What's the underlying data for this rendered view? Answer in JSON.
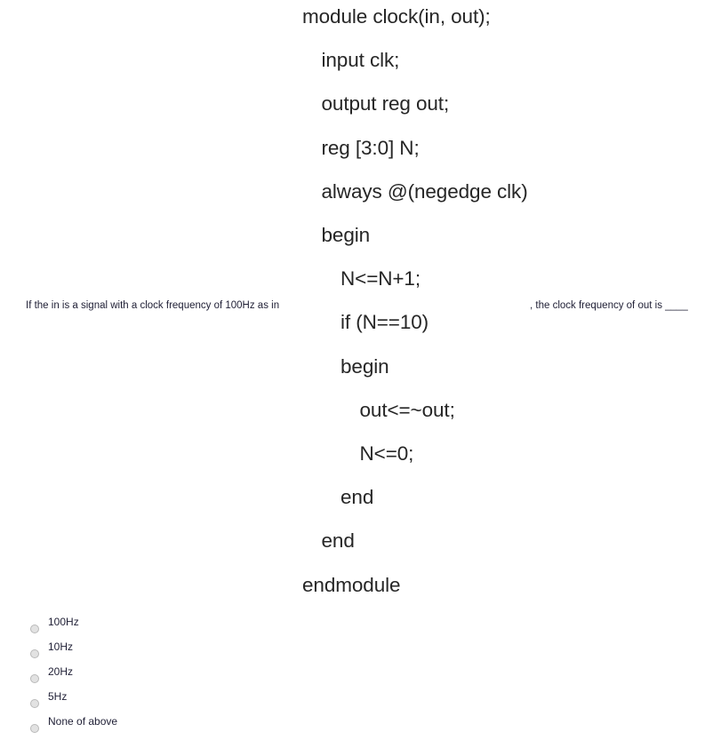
{
  "code": {
    "language": "verilog",
    "lines": [
      {
        "text": "module clock(in, out);",
        "indent": 0
      },
      {
        "text": "input clk;",
        "indent": 1
      },
      {
        "text": "output reg out;",
        "indent": 1
      },
      {
        "text": "reg [3:0] N;",
        "indent": 1
      },
      {
        "text": "always @(negedge clk)",
        "indent": 1
      },
      {
        "text": "begin",
        "indent": 1
      },
      {
        "text": "N<=N+1;",
        "indent": 2
      },
      {
        "text": "if (N==10)",
        "indent": 2
      },
      {
        "text": "begin",
        "indent": 2
      },
      {
        "text": "out<=~out;",
        "indent": 3
      },
      {
        "text": "N<=0;",
        "indent": 3
      },
      {
        "text": "end",
        "indent": 2
      },
      {
        "text": "end",
        "indent": 1
      },
      {
        "text": "endmodule",
        "indent": 0
      }
    ]
  },
  "question": {
    "fragment_left": "If the in is a signal with a clock frequency of 100Hz as in",
    "fragment_right": ", the clock frequency of out is ____"
  },
  "options": [
    {
      "label": "100Hz",
      "selected": false
    },
    {
      "label": "10Hz",
      "selected": false
    },
    {
      "label": "20Hz",
      "selected": false
    },
    {
      "label": "5Hz",
      "selected": false
    },
    {
      "label": "None of above",
      "selected": false
    }
  ],
  "colors": {
    "background": "#ffffff",
    "code_text": "#262626",
    "question_text": "#1f1f35",
    "radio_fill": "#e2e2e2",
    "radio_border": "#b9b9b9"
  }
}
